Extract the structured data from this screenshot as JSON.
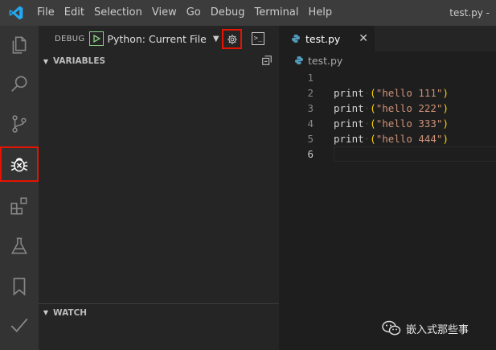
{
  "titlebar": {
    "menu": [
      "File",
      "Edit",
      "Selection",
      "View",
      "Go",
      "Debug",
      "Terminal",
      "Help"
    ],
    "window_title": "test.py -"
  },
  "activitybar": {
    "items": [
      {
        "name": "explorer",
        "icon": "files-icon"
      },
      {
        "name": "search",
        "icon": "search-icon"
      },
      {
        "name": "source-control",
        "icon": "source-control-icon"
      },
      {
        "name": "debug",
        "icon": "bug-icon",
        "active": true
      },
      {
        "name": "extensions",
        "icon": "extensions-icon"
      },
      {
        "name": "testing",
        "icon": "flask-icon"
      },
      {
        "name": "bookmarks",
        "icon": "bookmark-icon"
      },
      {
        "name": "tasks",
        "icon": "check-icon"
      }
    ]
  },
  "debug": {
    "label": "DEBUG",
    "configuration": "Python: Current File"
  },
  "sections": {
    "variables": "VARIABLES",
    "watch": "WATCH"
  },
  "editor": {
    "tab_label": "test.py",
    "breadcrumb": "test.py",
    "current_line": 6,
    "lines": [
      {
        "n": "1",
        "fn": "",
        "arg": ""
      },
      {
        "n": "2",
        "fn": "print",
        "arg": "\"hello 111\""
      },
      {
        "n": "3",
        "fn": "print",
        "arg": "\"hello 222\""
      },
      {
        "n": "4",
        "fn": "print",
        "arg": "\"hello 333\""
      },
      {
        "n": "5",
        "fn": "print",
        "arg": "\"hello 444\""
      },
      {
        "n": "6",
        "fn": "",
        "arg": ""
      }
    ]
  },
  "watermark": {
    "text": "嵌入式那些事"
  },
  "colors": {
    "highlight": "#e51400",
    "string": "#ce9178",
    "paren": "#ffd700"
  }
}
